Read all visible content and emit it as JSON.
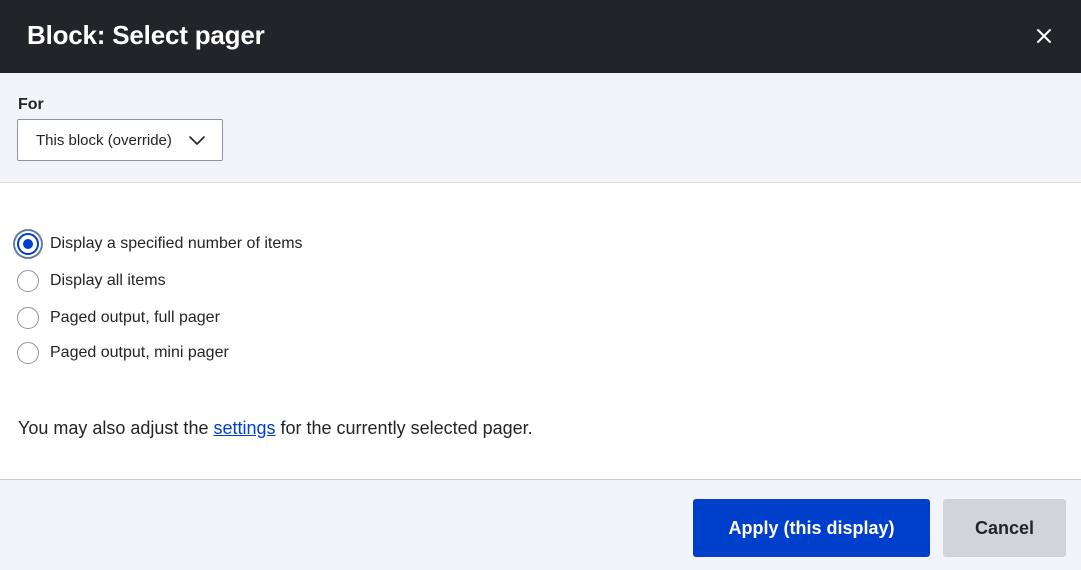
{
  "dialog": {
    "title": "Block: Select pager",
    "close_icon": "close-icon"
  },
  "for": {
    "label": "For",
    "selected": "This block (override)",
    "chevron_icon": "chevron-down-icon"
  },
  "pager_options": [
    {
      "label": "Display a specified number of items",
      "checked": true
    },
    {
      "label": "Display all items",
      "checked": false
    },
    {
      "label": "Paged output, full pager",
      "checked": false
    },
    {
      "label": "Paged output, mini pager",
      "checked": false
    }
  ],
  "description": {
    "before": "You may also adjust the ",
    "link": "settings",
    "after": " for the currently selected pager."
  },
  "buttons": {
    "apply": "Apply (this display)",
    "cancel": "Cancel"
  },
  "colors": {
    "titlebar_bg": "#232429",
    "accent": "#003ecc",
    "panel_bg": "#f3f4f9",
    "cancel_bg": "#d3d4d9"
  }
}
